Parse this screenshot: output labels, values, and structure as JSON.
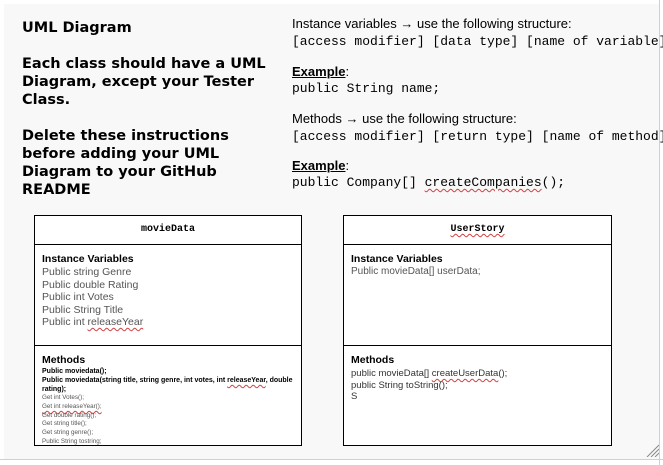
{
  "instructions_left": {
    "title": "UML Diagram",
    "line2": "Each class should have a UML Diagram, except your Tester Class.",
    "line3": "Delete these instructions before adding your UML Diagram to your GitHub README"
  },
  "instructions_right": {
    "ivars_heading": "Instance variables → use the following structure:",
    "ivars_structure": "[access modifier] [data type] [name of variable];",
    "ivars_example_label": "Example",
    "ivars_example_colon": ":",
    "ivars_example_code": "public String name;",
    "methods_heading": "Methods → use the following structure:",
    "methods_structure": "[access modifier] [return type] [name of method];",
    "methods_example_label": "Example",
    "methods_example_colon": ":",
    "methods_example_code_a": "public Company[] ",
    "methods_example_code_b": "createCompanies",
    "methods_example_code_c": "();"
  },
  "class_movie": {
    "name": "movieData",
    "ivars_title": "Instance Variables",
    "ivars": [
      "Public string Genre",
      "Public double Rating",
      "Public int Votes",
      "Public String Title"
    ],
    "ivar_last_prefix": "Public int ",
    "ivar_last_name": "releaseYear",
    "methods_title": "Methods",
    "methods_bold1": "Public moviedata();",
    "methods_bold2_a": "Public moviedata(string title, string genre, int votes, int ",
    "methods_bold2_b": "releaseYear",
    "methods_bold2_c": ", double rating);",
    "methods_small": [
      "Get int Votes();",
      "Get int releaseYear();",
      "Get double rating();",
      "Get string title();",
      "Get string genre();",
      "Public String tostring;"
    ]
  },
  "class_user": {
    "name": "UserStory",
    "ivars_title": "Instance Variables",
    "ivar1": "Public movieData[] userData;",
    "methods_title": "Methods",
    "method1_a": "public movieData[] ",
    "method1_b": "createUserData",
    "method1_c": "();",
    "method2": "public String toString();",
    "method3": "S"
  }
}
